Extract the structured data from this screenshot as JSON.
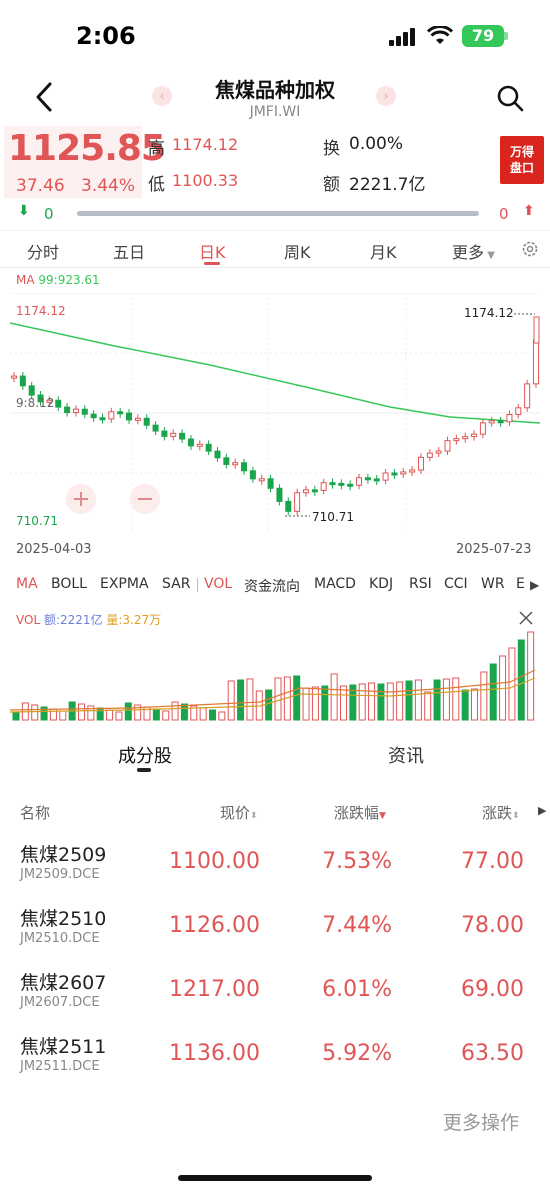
{
  "status": {
    "time": "2:06",
    "battery": "79"
  },
  "header": {
    "title": "焦煤品种加权",
    "code": "JMFI.WI"
  },
  "quote": {
    "price": "1125.85",
    "change": "37.46",
    "change_pct": "3.44%",
    "high_label": "高",
    "high": "1174.12",
    "low_label": "低",
    "low": "1100.33",
    "turnover_label": "换",
    "turnover": "0.00%",
    "amount_label": "额",
    "amount": "2221.7亿",
    "badge_line1": "万得",
    "badge_line2": "盘口",
    "down_count": "0",
    "up_count": "0"
  },
  "tabs": [
    "分时",
    "五日",
    "日K",
    "周K",
    "月K",
    "更多"
  ],
  "active_tab": 2,
  "chart": {
    "ma_label": "MA",
    "ma_value": "99:923.61",
    "y_top_label": "1174.12",
    "y_bottom_label": "710.71",
    "high_annot": "1174.12",
    "low_annot": "710.71",
    "mid_label": "9:8.12",
    "start_date": "2025-04-03",
    "end_date": "2025-07-23"
  },
  "indicators": [
    "MA",
    "BOLL",
    "EXPMA",
    "SAR",
    "VOL",
    "资金流向",
    "MACD",
    "KDJ",
    "RSI",
    "CCI",
    "WR",
    "E"
  ],
  "volume": {
    "label": "VOL",
    "amount_text": "额:2221亿",
    "qty_text": "量:3.27万"
  },
  "chart_data": {
    "type": "candlestick",
    "x_range": [
      "2025-04-03",
      "2025-07-23"
    ],
    "ylim": [
      710.71,
      1174.12
    ],
    "ma99_last": 923.61,
    "volume_amount": "2221亿",
    "volume_qty": "3.27万"
  },
  "segments": [
    "成分股",
    "资讯"
  ],
  "table": {
    "headers": [
      "名称",
      "现价",
      "涨跌幅",
      "涨跌"
    ],
    "rows": [
      {
        "name": "焦煤2509",
        "code": "JM2509.DCE",
        "price": "1100.00",
        "pct": "7.53%",
        "chg": "77.00"
      },
      {
        "name": "焦煤2510",
        "code": "JM2510.DCE",
        "price": "1126.00",
        "pct": "7.44%",
        "chg": "78.00"
      },
      {
        "name": "焦煤2607",
        "code": "JM2607.DCE",
        "price": "1217.00",
        "pct": "6.01%",
        "chg": "69.00"
      },
      {
        "name": "焦煤2511",
        "code": "JM2511.DCE",
        "price": "1136.00",
        "pct": "5.92%",
        "chg": "63.50"
      }
    ]
  },
  "footer": {
    "more": "更多操作"
  },
  "colors": {
    "up": "#e05555",
    "down": "#1aa54d",
    "ma": "#36c759"
  }
}
